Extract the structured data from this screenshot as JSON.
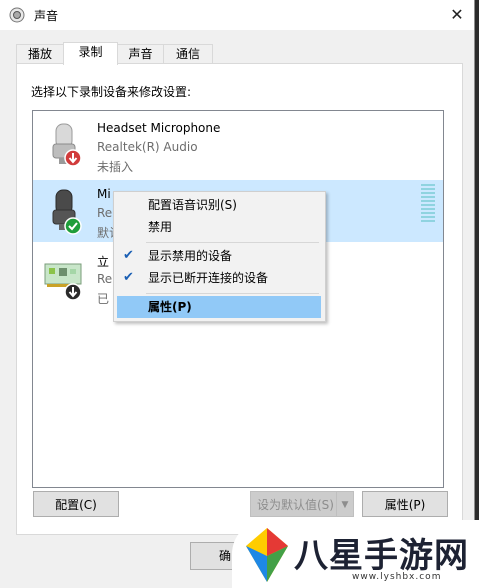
{
  "window": {
    "title": "声音",
    "close_glyph": "✕"
  },
  "tabs": [
    {
      "label": "播放",
      "active": false
    },
    {
      "label": "录制",
      "active": true
    },
    {
      "label": "声音",
      "active": false
    },
    {
      "label": "通信",
      "active": false
    }
  ],
  "instruction": "选择以下录制设备来修改设置:",
  "devices": [
    {
      "name": "Headset Microphone",
      "driver": "Realtek(R) Audio",
      "status": "未插入",
      "icon": "microphone-icon",
      "badge": "unplugged-red-arrow"
    },
    {
      "name": "Mi",
      "driver": "Re",
      "status": "默认",
      "icon": "microphone-icon",
      "badge": "default-green-check",
      "selected": true
    },
    {
      "name": "立",
      "driver": "Re",
      "status": "已",
      "icon": "sound-card-icon",
      "badge": "disabled-black-arrow"
    }
  ],
  "context_menu": {
    "items": [
      {
        "label": "配置语音识别(S)",
        "checked": false
      },
      {
        "label": "禁用",
        "checked": false
      },
      {
        "label": "显示禁用的设备",
        "checked": true
      },
      {
        "label": "显示已断开连接的设备",
        "checked": true
      },
      {
        "label": "属性(P)",
        "checked": false,
        "highlight": true,
        "bold": true
      }
    ],
    "check_glyph": "✔"
  },
  "buttons": {
    "configure": "配置(C)",
    "set_default": "设为默认值(S)",
    "properties": "属性(P)",
    "ok_partial": "确"
  },
  "watermark": {
    "text": "八星手游网",
    "url": "www.lyshbx.com"
  },
  "colors": {
    "selection": "#cce8ff",
    "menu_highlight": "#91c9f7",
    "check": "#1a5fb4"
  }
}
